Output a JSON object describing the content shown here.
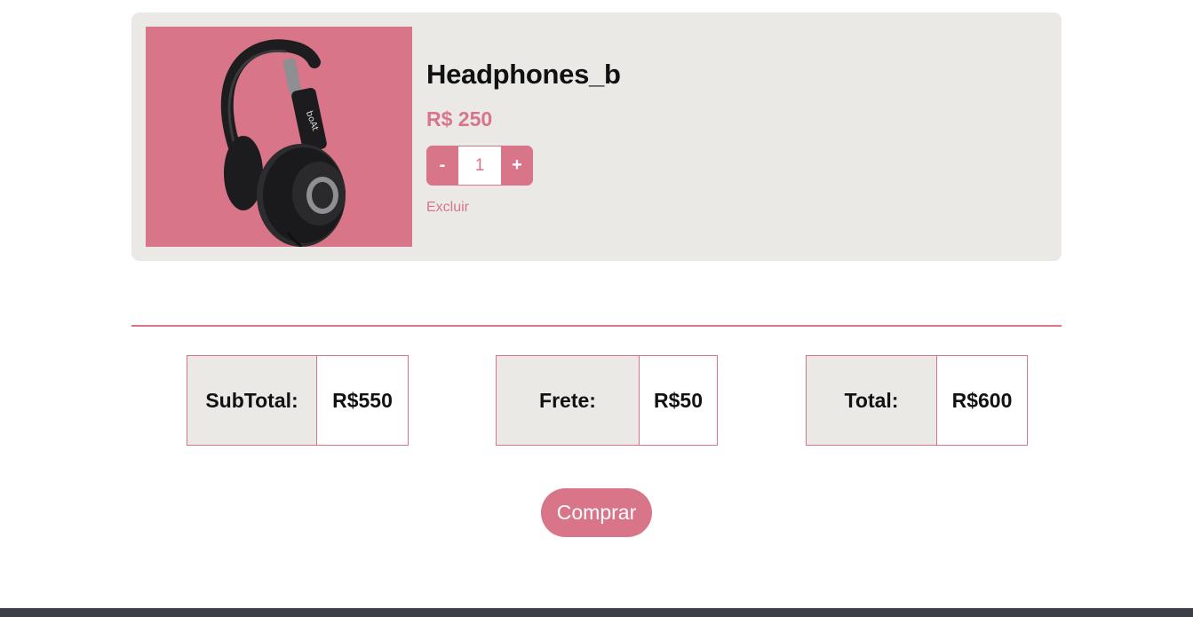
{
  "cart": {
    "items": [
      {
        "name": "Headphones_b",
        "price": "R$ 250",
        "quantity": "1",
        "decrement_label": "-",
        "increment_label": "+",
        "remove_label": "Excluir",
        "image_background": "#d97589"
      }
    ]
  },
  "summary": {
    "subtotal": {
      "label": "SubTotal:",
      "value": "R$550"
    },
    "shipping": {
      "label": "Frete:",
      "value": "R$50"
    },
    "total": {
      "label": "Total:",
      "value": "R$600"
    }
  },
  "actions": {
    "buy_label": "Comprar"
  },
  "colors": {
    "accent": "#d97589",
    "card_background": "#ebe9e6",
    "footer": "#3c3f47"
  }
}
